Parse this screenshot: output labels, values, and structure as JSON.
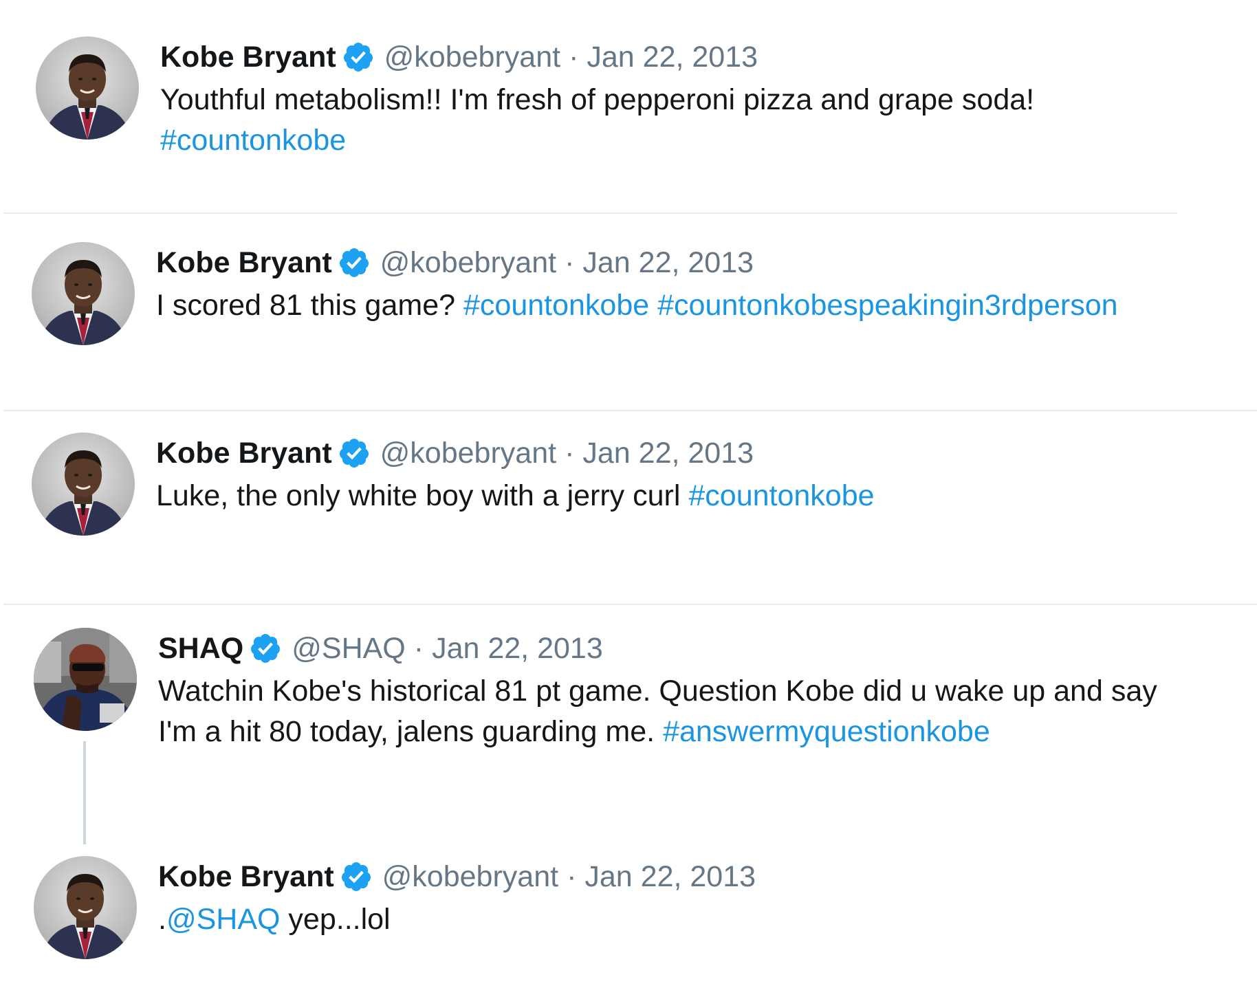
{
  "tweets": [
    {
      "name": "Kobe Bryant",
      "handle": "@kobebryant",
      "separator": "·",
      "date": "Jan 22, 2013",
      "text_1": "Youthful metabolism!! I'm fresh of pepperoni pizza and grape soda!",
      "hashtag_1": "#countonkobe",
      "avatar_icon": "kobe-childhood-photo-avatar",
      "verified_icon": "verified-badge-icon"
    },
    {
      "name": "Kobe Bryant",
      "handle": "@kobebryant",
      "separator": "·",
      "date": "Jan 22, 2013",
      "text_1": "I scored 81 this game?",
      "hashtag_1": "#countonkobe",
      "hashtag_2": "#countonkobespeakingin3rdperson",
      "avatar_icon": "kobe-childhood-photo-avatar",
      "verified_icon": "verified-badge-icon"
    },
    {
      "name": "Kobe Bryant",
      "handle": "@kobebryant",
      "separator": "·",
      "date": "Jan 22, 2013",
      "text_1": "Luke, the only white boy with a jerry curl",
      "hashtag_1": "#countonkobe",
      "avatar_icon": "kobe-childhood-photo-avatar",
      "verified_icon": "verified-badge-icon"
    },
    {
      "name": "SHAQ",
      "handle": "@SHAQ",
      "separator": "·",
      "date": "Jan 22, 2013",
      "text_1": "Watchin Kobe's historical 81 pt game. Question Kobe did u wake up and say",
      "text_2": "I'm a hit 80 today,  jalens guarding me.",
      "hashtag_1": "#answermyquestionkobe",
      "avatar_icon": "shaq-sunglasses-avatar",
      "verified_icon": "verified-badge-icon"
    },
    {
      "name": "Kobe Bryant",
      "handle": "@kobebryant",
      "separator": "·",
      "date": "Jan 22, 2013",
      "prefix": ".",
      "mention": "@SHAQ",
      "text_1": " yep...lol",
      "avatar_icon": "kobe-childhood-photo-avatar",
      "verified_icon": "verified-badge-icon"
    }
  ],
  "colors": {
    "link": "#1b95e0",
    "verified": "#1da1f2",
    "muted": "#657786",
    "divider": "#e6ecf0",
    "thread_line": "#ccd6dd"
  }
}
